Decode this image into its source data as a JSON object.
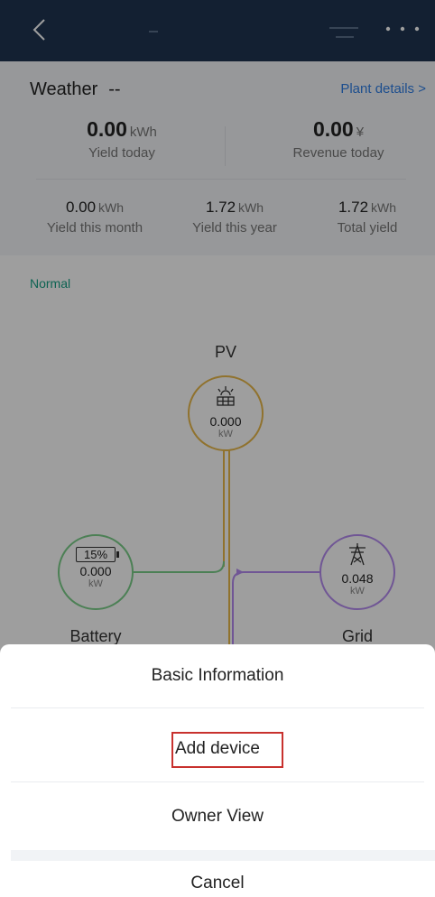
{
  "weather": {
    "label": "Weather",
    "value": "--"
  },
  "plant_details_link": "Plant details >",
  "yield_today": {
    "value": "0.00",
    "unit": "kWh",
    "label": "Yield today"
  },
  "revenue_today": {
    "value": "0.00",
    "unit": "¥",
    "label": "Revenue today"
  },
  "yield_month": {
    "value": "0.00",
    "unit": "kWh",
    "label": "Yield this month"
  },
  "yield_year": {
    "value": "1.72",
    "unit": "kWh",
    "label": "Yield this year"
  },
  "total_yield": {
    "value": "1.72",
    "unit": "kWh",
    "label": "Total yield"
  },
  "status": "Normal",
  "flow": {
    "pv": {
      "label": "PV",
      "value": "0.000",
      "unit": "kW"
    },
    "battery": {
      "label": "Battery",
      "percent": "15%",
      "value": "0.000",
      "unit": "kW"
    },
    "grid": {
      "label": "Grid",
      "value": "0.048",
      "unit": "kW"
    }
  },
  "sheet": {
    "basic_info": "Basic Information",
    "add_device": "Add device",
    "owner_view": "Owner View",
    "cancel": "Cancel"
  },
  "colors": {
    "header": "#1f3552",
    "link": "#2f7fe6",
    "status": "#16a085",
    "pv": "#e8b84a",
    "battery": "#7bcf8a",
    "grid": "#b58cf0",
    "highlight": "#c8312e"
  }
}
